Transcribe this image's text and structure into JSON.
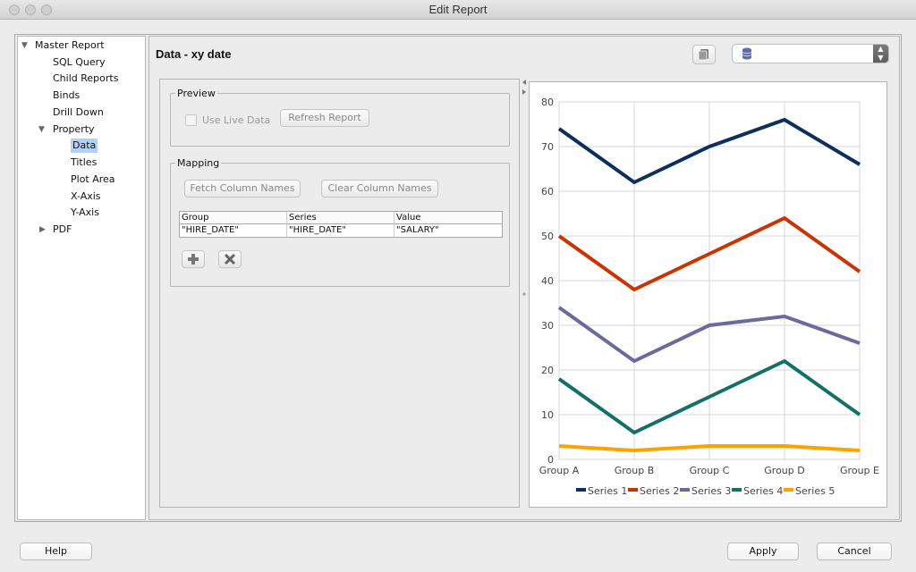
{
  "window": {
    "title": "Edit Report"
  },
  "tree": {
    "items": [
      {
        "label": "Master Report",
        "level": 0,
        "expanded": true
      },
      {
        "label": "SQL Query",
        "level": 1
      },
      {
        "label": "Child Reports",
        "level": 1
      },
      {
        "label": "Binds",
        "level": 1
      },
      {
        "label": "Drill Down",
        "level": 1
      },
      {
        "label": "Property",
        "level": 1,
        "expanded": true
      },
      {
        "label": "Data",
        "level": 2,
        "selected": true
      },
      {
        "label": "Titles",
        "level": 2
      },
      {
        "label": "Plot Area",
        "level": 2
      },
      {
        "label": "X-Axis",
        "level": 2
      },
      {
        "label": "Y-Axis",
        "level": 2
      },
      {
        "label": "PDF",
        "level": 0,
        "expanded": false
      }
    ]
  },
  "header": {
    "title": "Data - xy date",
    "connection_icon": "database-icon"
  },
  "preview": {
    "legend": "Preview",
    "use_live_data_label": "Use Live Data",
    "use_live_data_checked": false,
    "refresh_label": "Refresh Report"
  },
  "mapping": {
    "legend": "Mapping",
    "fetch_label": "Fetch Column Names",
    "clear_label": "Clear Column Names",
    "columns": [
      "Group",
      "Series",
      "Value"
    ],
    "rows": [
      [
        "\"HIRE_DATE\"",
        "\"HIRE_DATE\"",
        "\"SALARY\""
      ]
    ]
  },
  "footer": {
    "help_label": "Help",
    "apply_label": "Apply",
    "cancel_label": "Cancel"
  },
  "chart_data": {
    "type": "line",
    "categories": [
      "Group A",
      "Group B",
      "Group C",
      "Group D",
      "Group E"
    ],
    "ylim": [
      0,
      80
    ],
    "yticks": [
      0,
      10,
      20,
      30,
      40,
      50,
      60,
      70,
      80
    ],
    "grid": true,
    "legend_position": "bottom",
    "series": [
      {
        "name": "Series 1",
        "color": "#0d2f5e",
        "values": [
          74,
          62,
          70,
          76,
          66
        ]
      },
      {
        "name": "Series 2",
        "color": "#cc3300",
        "values": [
          50,
          38,
          46,
          54,
          42
        ]
      },
      {
        "name": "Series 3",
        "color": "#6a6a9e",
        "values": [
          34,
          22,
          30,
          32,
          26
        ]
      },
      {
        "name": "Series 4",
        "color": "#127068",
        "values": [
          18,
          6,
          14,
          22,
          10
        ]
      },
      {
        "name": "Series 5",
        "color": "#ffa200",
        "values": [
          3,
          2,
          3,
          3,
          2
        ]
      }
    ]
  }
}
